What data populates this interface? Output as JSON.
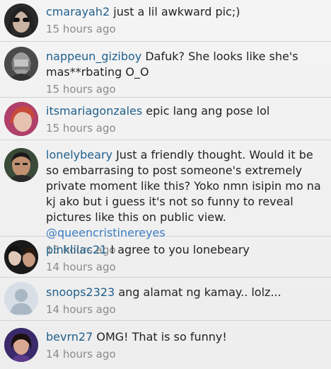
{
  "comments": [
    {
      "username": "cmarayah2",
      "text": "just a lil awkward pic;)",
      "time": "15 hours ago",
      "avatar": "woman-with-sunglasses-avatar"
    },
    {
      "username": "nappeun_giziboy",
      "text": "Dafuk? She looks like she's mas**rbating O_O",
      "time": "15 hours ago",
      "avatar": "man-covering-face-avatar"
    },
    {
      "username": "itsmariagonzales",
      "text": "epic lang ang pose lol",
      "time": "15 hours ago",
      "avatar": "girl-with-red-hair-avatar"
    },
    {
      "username": "lonelybeary",
      "text": "Just a friendly thought. Would it be so embarrasing to post someone's extremely private moment like this? Yoko nmn isipin mo na kj ako but i guess it's not so funny to reveal pictures like this on public view.",
      "mention": "@queencristinereyes",
      "time": "15 hours ago",
      "avatar": "man-portrait-avatar"
    },
    {
      "username": "pinklilac21",
      "text": "I agree to you lonebeary",
      "time": "14 hours ago",
      "avatar": "two-girls-avatar"
    },
    {
      "username": "snoops2323",
      "text": "ang alamat ng kamay.. lolz...",
      "time": "14 hours ago",
      "avatar": "default-user-avatar"
    },
    {
      "username": "bevrn27",
      "text": "OMG! That is so funny!",
      "time": "14 hours ago",
      "avatar": "girl-portrait-avatar"
    }
  ]
}
